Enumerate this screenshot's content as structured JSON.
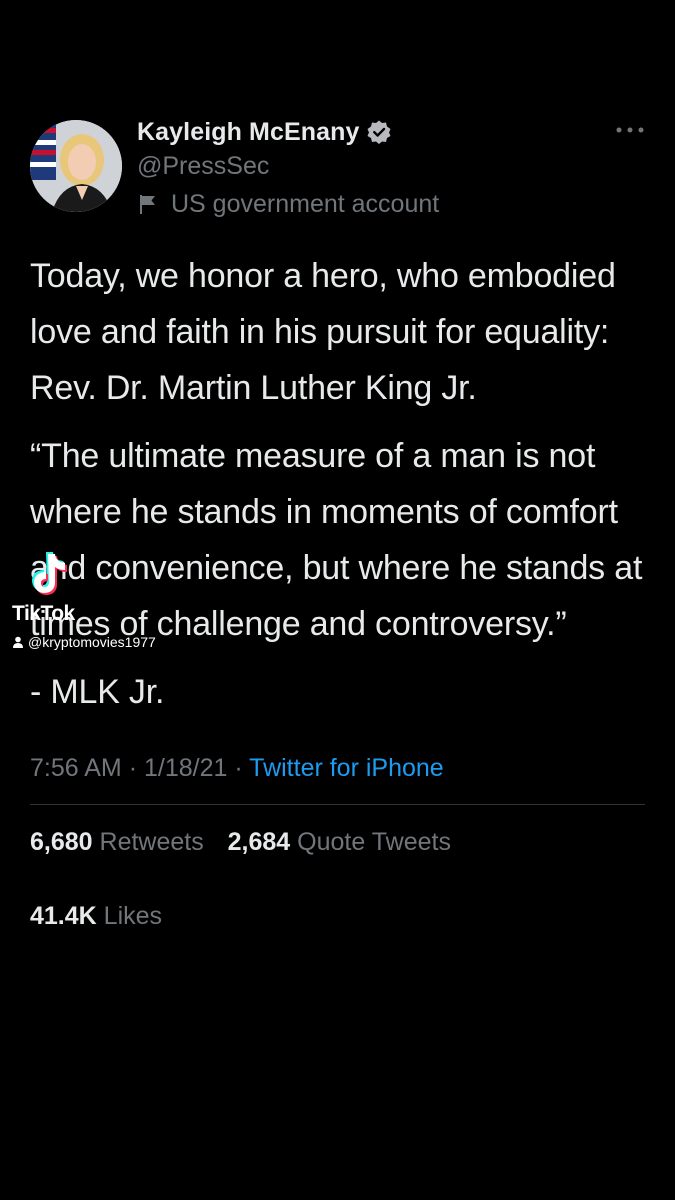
{
  "tweet": {
    "display_name": "Kayleigh McEnany",
    "handle": "@PressSec",
    "account_label": "US government account",
    "paragraphs": [
      "Today, we honor a hero, who embodied love and faith in his pursuit for equality: Rev. Dr. Martin Luther King Jr.",
      "“The ultimate measure of a man is not where he stands in moments of comfort and convenience, but where he stands at times of challenge and controversy.”",
      "- MLK Jr."
    ],
    "time": "7:56 AM",
    "date": "1/18/21",
    "source": "Twitter for iPhone",
    "separator": "·",
    "retweets_count": "6,680",
    "retweets_label": "Retweets",
    "quote_count": "2,684",
    "quote_label": "Quote Tweets",
    "likes_count": "41.4K",
    "likes_label": "Likes"
  },
  "watermark": {
    "brand": "TikTok",
    "username": "@kryptomovies1977"
  },
  "icons": {
    "verified": "verified-badge-icon",
    "government": "flag-icon",
    "more": "more-icon",
    "tiktok": "tiktok-logo-icon",
    "user": "user-icon"
  },
  "colors": {
    "background": "#000000",
    "text": "#e7e9ea",
    "secondary": "#71767b",
    "link": "#1d9bf0"
  }
}
